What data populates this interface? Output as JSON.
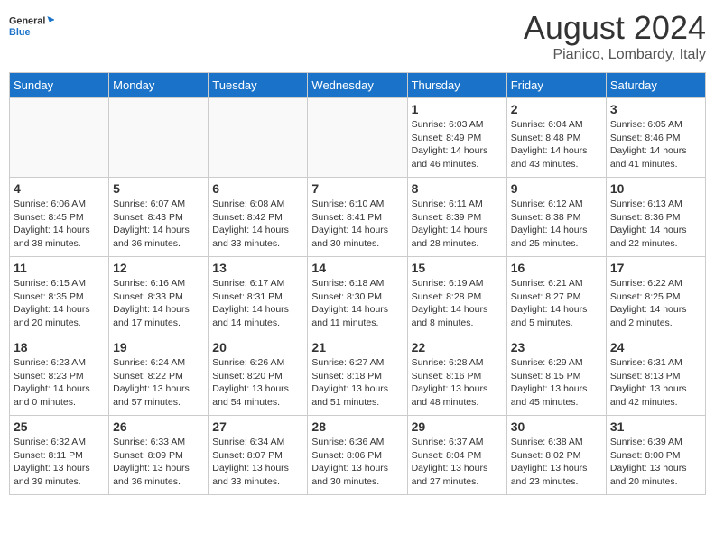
{
  "header": {
    "logo_line1": "General",
    "logo_line2": "Blue",
    "month": "August 2024",
    "location": "Pianico, Lombardy, Italy"
  },
  "days_of_week": [
    "Sunday",
    "Monday",
    "Tuesday",
    "Wednesday",
    "Thursday",
    "Friday",
    "Saturday"
  ],
  "weeks": [
    [
      {
        "day": "",
        "info": ""
      },
      {
        "day": "",
        "info": ""
      },
      {
        "day": "",
        "info": ""
      },
      {
        "day": "",
        "info": ""
      },
      {
        "day": "1",
        "info": "Sunrise: 6:03 AM\nSunset: 8:49 PM\nDaylight: 14 hours\nand 46 minutes."
      },
      {
        "day": "2",
        "info": "Sunrise: 6:04 AM\nSunset: 8:48 PM\nDaylight: 14 hours\nand 43 minutes."
      },
      {
        "day": "3",
        "info": "Sunrise: 6:05 AM\nSunset: 8:46 PM\nDaylight: 14 hours\nand 41 minutes."
      }
    ],
    [
      {
        "day": "4",
        "info": "Sunrise: 6:06 AM\nSunset: 8:45 PM\nDaylight: 14 hours\nand 38 minutes."
      },
      {
        "day": "5",
        "info": "Sunrise: 6:07 AM\nSunset: 8:43 PM\nDaylight: 14 hours\nand 36 minutes."
      },
      {
        "day": "6",
        "info": "Sunrise: 6:08 AM\nSunset: 8:42 PM\nDaylight: 14 hours\nand 33 minutes."
      },
      {
        "day": "7",
        "info": "Sunrise: 6:10 AM\nSunset: 8:41 PM\nDaylight: 14 hours\nand 30 minutes."
      },
      {
        "day": "8",
        "info": "Sunrise: 6:11 AM\nSunset: 8:39 PM\nDaylight: 14 hours\nand 28 minutes."
      },
      {
        "day": "9",
        "info": "Sunrise: 6:12 AM\nSunset: 8:38 PM\nDaylight: 14 hours\nand 25 minutes."
      },
      {
        "day": "10",
        "info": "Sunrise: 6:13 AM\nSunset: 8:36 PM\nDaylight: 14 hours\nand 22 minutes."
      }
    ],
    [
      {
        "day": "11",
        "info": "Sunrise: 6:15 AM\nSunset: 8:35 PM\nDaylight: 14 hours\nand 20 minutes."
      },
      {
        "day": "12",
        "info": "Sunrise: 6:16 AM\nSunset: 8:33 PM\nDaylight: 14 hours\nand 17 minutes."
      },
      {
        "day": "13",
        "info": "Sunrise: 6:17 AM\nSunset: 8:31 PM\nDaylight: 14 hours\nand 14 minutes."
      },
      {
        "day": "14",
        "info": "Sunrise: 6:18 AM\nSunset: 8:30 PM\nDaylight: 14 hours\nand 11 minutes."
      },
      {
        "day": "15",
        "info": "Sunrise: 6:19 AM\nSunset: 8:28 PM\nDaylight: 14 hours\nand 8 minutes."
      },
      {
        "day": "16",
        "info": "Sunrise: 6:21 AM\nSunset: 8:27 PM\nDaylight: 14 hours\nand 5 minutes."
      },
      {
        "day": "17",
        "info": "Sunrise: 6:22 AM\nSunset: 8:25 PM\nDaylight: 14 hours\nand 2 minutes."
      }
    ],
    [
      {
        "day": "18",
        "info": "Sunrise: 6:23 AM\nSunset: 8:23 PM\nDaylight: 14 hours\nand 0 minutes."
      },
      {
        "day": "19",
        "info": "Sunrise: 6:24 AM\nSunset: 8:22 PM\nDaylight: 13 hours\nand 57 minutes."
      },
      {
        "day": "20",
        "info": "Sunrise: 6:26 AM\nSunset: 8:20 PM\nDaylight: 13 hours\nand 54 minutes."
      },
      {
        "day": "21",
        "info": "Sunrise: 6:27 AM\nSunset: 8:18 PM\nDaylight: 13 hours\nand 51 minutes."
      },
      {
        "day": "22",
        "info": "Sunrise: 6:28 AM\nSunset: 8:16 PM\nDaylight: 13 hours\nand 48 minutes."
      },
      {
        "day": "23",
        "info": "Sunrise: 6:29 AM\nSunset: 8:15 PM\nDaylight: 13 hours\nand 45 minutes."
      },
      {
        "day": "24",
        "info": "Sunrise: 6:31 AM\nSunset: 8:13 PM\nDaylight: 13 hours\nand 42 minutes."
      }
    ],
    [
      {
        "day": "25",
        "info": "Sunrise: 6:32 AM\nSunset: 8:11 PM\nDaylight: 13 hours\nand 39 minutes."
      },
      {
        "day": "26",
        "info": "Sunrise: 6:33 AM\nSunset: 8:09 PM\nDaylight: 13 hours\nand 36 minutes."
      },
      {
        "day": "27",
        "info": "Sunrise: 6:34 AM\nSunset: 8:07 PM\nDaylight: 13 hours\nand 33 minutes."
      },
      {
        "day": "28",
        "info": "Sunrise: 6:36 AM\nSunset: 8:06 PM\nDaylight: 13 hours\nand 30 minutes."
      },
      {
        "day": "29",
        "info": "Sunrise: 6:37 AM\nSunset: 8:04 PM\nDaylight: 13 hours\nand 27 minutes."
      },
      {
        "day": "30",
        "info": "Sunrise: 6:38 AM\nSunset: 8:02 PM\nDaylight: 13 hours\nand 23 minutes."
      },
      {
        "day": "31",
        "info": "Sunrise: 6:39 AM\nSunset: 8:00 PM\nDaylight: 13 hours\nand 20 minutes."
      }
    ]
  ]
}
